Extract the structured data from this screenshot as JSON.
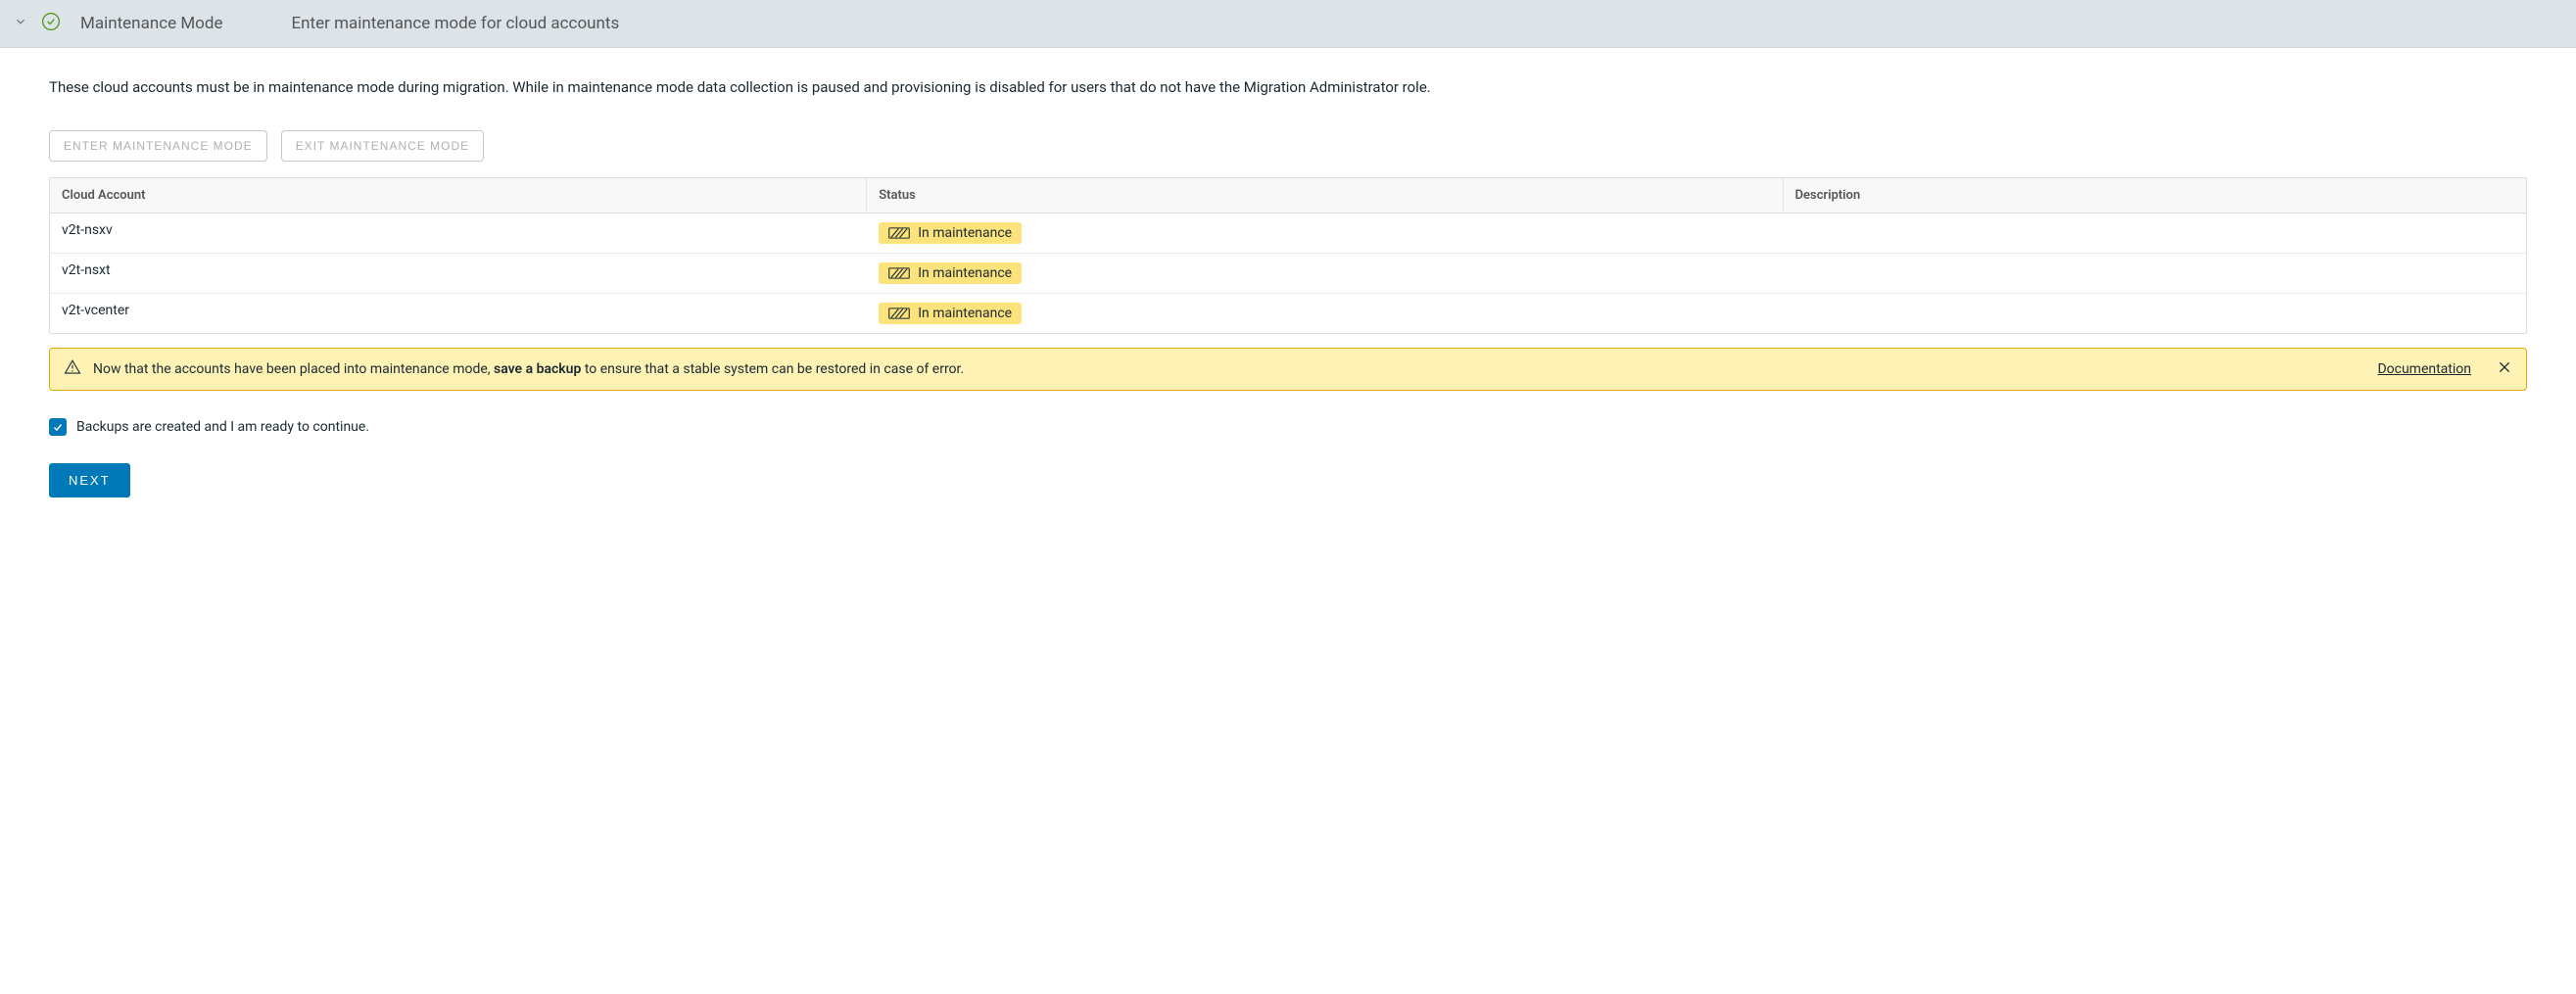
{
  "header": {
    "title": "Maintenance Mode",
    "subtitle": "Enter maintenance mode for cloud accounts"
  },
  "intro": "These cloud accounts must be in maintenance mode during migration. While in maintenance mode data collection is paused and provisioning is disabled for users that do not have the Migration Administrator role.",
  "buttons": {
    "enter": "ENTER MAINTENANCE MODE",
    "exit": "EXIT MAINTENANCE MODE",
    "next": "NEXT"
  },
  "table": {
    "columns": {
      "account": "Cloud Account",
      "status": "Status",
      "description": "Description"
    },
    "rows": [
      {
        "account": "v2t-nsxv",
        "status": "In maintenance",
        "description": ""
      },
      {
        "account": "v2t-nsxt",
        "status": "In maintenance",
        "description": ""
      },
      {
        "account": "v2t-vcenter",
        "status": "In maintenance",
        "description": ""
      }
    ]
  },
  "alert": {
    "prefix": "Now that the accounts have been placed into maintenance mode, ",
    "bold": "save a backup",
    "suffix": " to ensure that a stable system can be restored in case of error.",
    "link": "Documentation"
  },
  "checkbox": {
    "label": "Backups are created and I am ready to continue.",
    "checked": true
  }
}
